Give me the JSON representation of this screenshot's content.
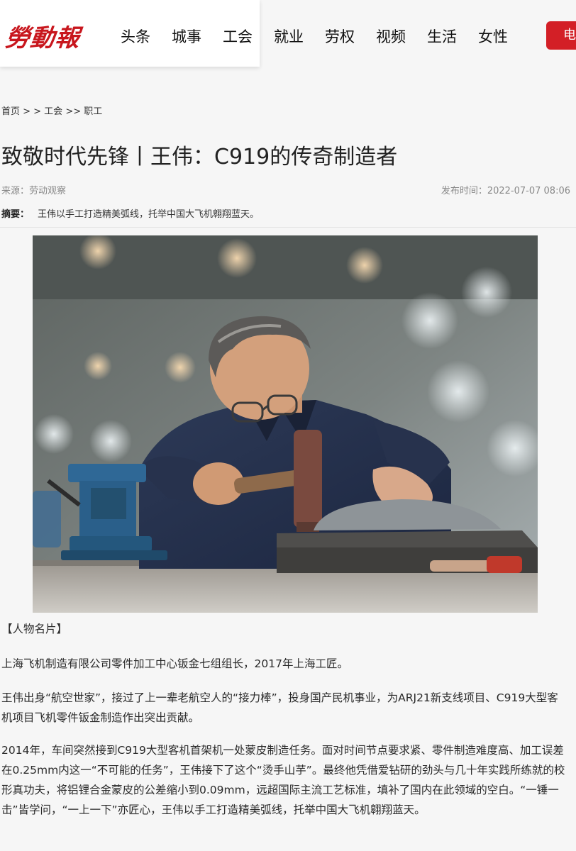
{
  "header": {
    "logo_text": "勞動報",
    "nav": [
      "头条",
      "城事",
      "工会",
      "就业",
      "劳权",
      "视频",
      "生活",
      "女性"
    ],
    "red_button_text": "电"
  },
  "breadcrumb": "首页 > > 工会 >> 职工",
  "article": {
    "title": "致敬时代先锋丨王伟：C919的传奇制造者",
    "source": "来源：劳动观察",
    "publish_time": "发布时间：2022-07-07 08:06",
    "summary_label": "摘要：",
    "summary_text": "王伟以手工打造精美弧线，托举中国大飞机翱翔蓝天。",
    "paragraphs": [
      "【人物名片】",
      "上海飞机制造有限公司零件加工中心钣金七组组长，2017年上海工匠。",
      "王伟出身“航空世家”，接过了上一辈老航空人的“接力棒”，投身国产民机事业，为ARJ21新支线项目、C919大型客机项目飞机零件钣金制造作出突出贡献。",
      "2014年，车间突然接到C919大型客机首架机一处蒙皮制造任务。面对时间节点要求紧、零件制造难度高、加工误差在0.25mm内这一“不可能的任务”，王伟接下了这个“烫手山芋”。最终他凭借爱钻研的劲头与几十年实践所练就的校形真功夫，将铝锂合金蒙皮的公差缩小到0.09mm，远超国际主流工艺标准，填补了国内在此领域的空白。“一锤一击”皆学问，“一上一下”亦匠心，王伟以手工打造精美弧线，托举中国大飞机翱翔蓝天。"
    ]
  },
  "colors": {
    "brand_red": "#c8161d",
    "button_red": "#d31f26",
    "background": "#f6f6f6"
  }
}
